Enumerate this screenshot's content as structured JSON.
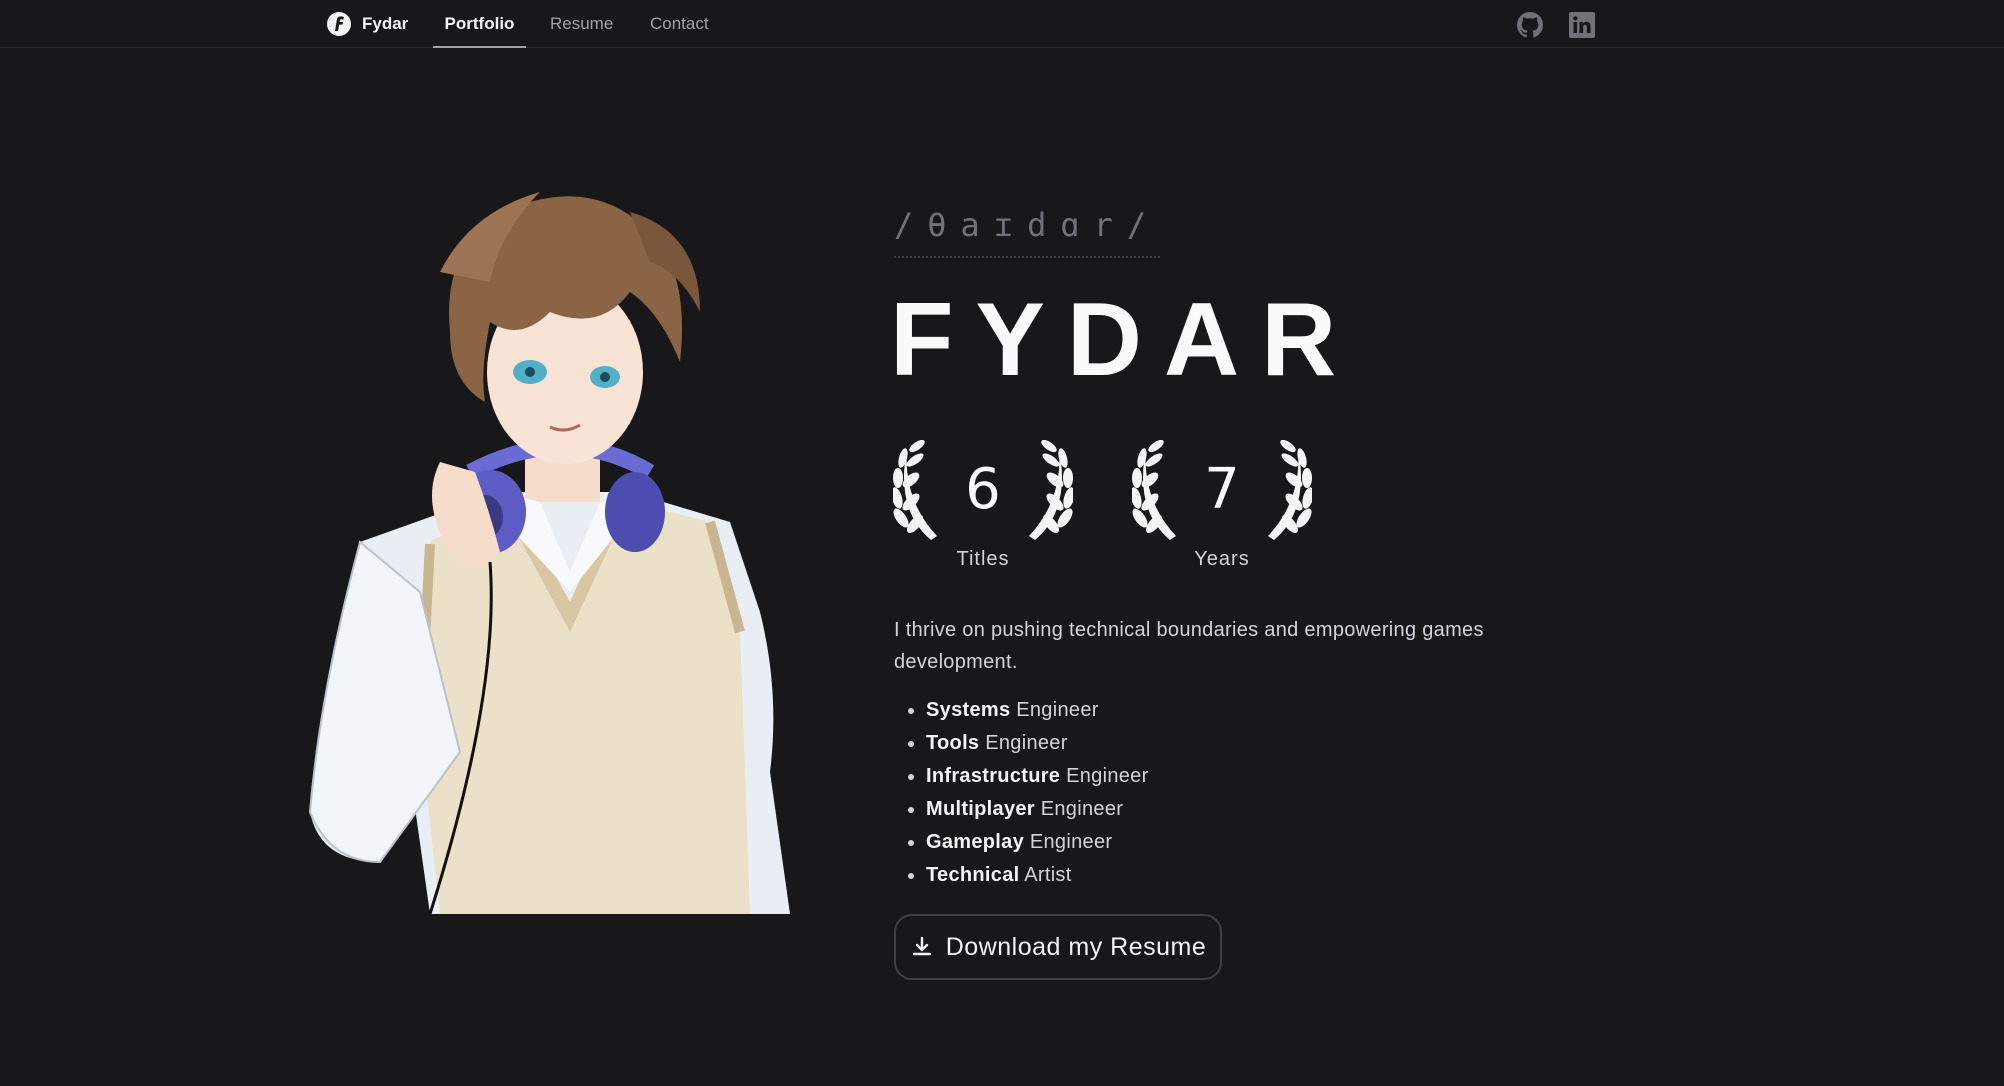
{
  "nav": {
    "brand": "Fydar",
    "links": [
      {
        "label": "Portfolio",
        "active": true
      },
      {
        "label": "Resume",
        "active": false
      },
      {
        "label": "Contact",
        "active": false
      }
    ],
    "icons": [
      "github-icon",
      "linkedin-icon"
    ]
  },
  "hero": {
    "phonetic": "/θaɪdɑr/",
    "name": "FYDAR",
    "stats": [
      {
        "value": "6",
        "label": "Titles"
      },
      {
        "value": "7",
        "label": "Years"
      }
    ],
    "intro": "I thrive on pushing technical boundaries and empowering games development.",
    "roles": [
      {
        "bold": "Systems",
        "rest": " Engineer"
      },
      {
        "bold": "Tools",
        "rest": " Engineer"
      },
      {
        "bold": "Infrastructure",
        "rest": " Engineer"
      },
      {
        "bold": "Multiplayer",
        "rest": " Engineer"
      },
      {
        "bold": "Gameplay",
        "rest": " Engineer"
      },
      {
        "bold": "Technical",
        "rest": " Artist"
      }
    ],
    "download_label": "Download my Resume"
  },
  "colors": {
    "background": "#18181b",
    "text": "#e4e4e7",
    "muted": "#a1a1aa",
    "border": "#3f3f46"
  }
}
